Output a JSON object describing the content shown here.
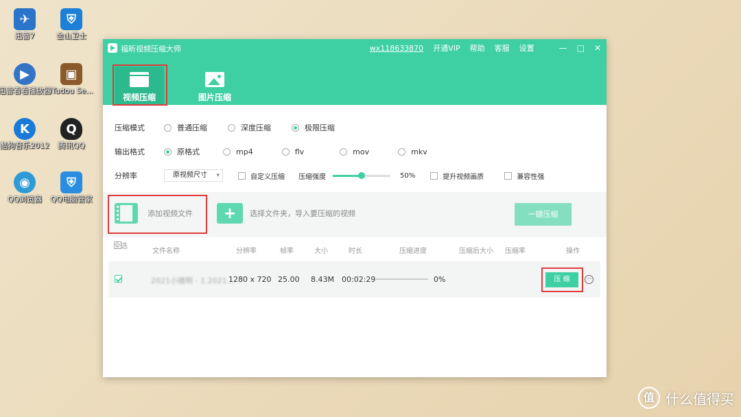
{
  "desktop": {
    "icons": [
      {
        "label": "迅雷7",
        "icon": "thunder-icon",
        "color": "#2a74c9"
      },
      {
        "label": "金山卫士",
        "icon": "kingsoft-guard-icon",
        "color": "#1d7fd6"
      },
      {
        "label": "迅雷看看播放器",
        "icon": "xunlei-player-icon",
        "color": "#3175c4"
      },
      {
        "label": "iTudou Se...",
        "icon": "tudou-icon",
        "color": "#8a5a2b"
      },
      {
        "label": "酷狗音乐2012",
        "icon": "kugou-icon",
        "color": "#1a7ad9"
      },
      {
        "label": "腾讯QQ",
        "icon": "qq-penguin-icon",
        "color": "#222222"
      },
      {
        "label": "QQ浏览器",
        "icon": "qq-browser-icon",
        "color": "#2f9bd6"
      },
      {
        "label": "QQ电脑管家",
        "icon": "qq-pc-manager-icon",
        "color": "#2a8de0"
      }
    ]
  },
  "window": {
    "title": "福昕视频压缩大师",
    "account": "wx118633870",
    "nav": {
      "vip": "开通VIP",
      "help": "帮助",
      "service": "客服",
      "settings": "设置"
    },
    "controls": {
      "min": "—",
      "max": "□",
      "close": "✕"
    },
    "tabs": [
      {
        "label": "视频压缩",
        "icon": "clapperboard-icon",
        "active": true
      },
      {
        "label": "图片压缩",
        "icon": "image-icon",
        "active": false
      }
    ]
  },
  "settings": {
    "mode": {
      "label": "压缩模式",
      "options": [
        "普通压缩",
        "深度压缩",
        "极限压缩"
      ],
      "selected": 2
    },
    "format": {
      "label": "输出格式",
      "options": [
        "原格式",
        "mp4",
        "flv",
        "mov",
        "mkv"
      ],
      "selected": 0
    },
    "resolution": {
      "label": "分辨率",
      "select_value": "原视频尺寸",
      "custom_label": "自定义压缩",
      "strength_label": "压缩强度",
      "strength_value": 50,
      "strength_text": "50%",
      "enhance_label": "提升视频画质",
      "compat_label": "兼容性强"
    }
  },
  "actions": {
    "add_file": "添加视频文件",
    "add_folder": "选择文件夹，导入要压缩的视频",
    "one_click": "一键压缩"
  },
  "table": {
    "headers": [
      "全选",
      "文件名称",
      "分辨率",
      "帧率",
      "大小",
      "时长",
      "压缩进度",
      "压缩后大小",
      "压缩率",
      "操作"
    ],
    "rows": [
      {
        "checked": true,
        "name": "2021小猪啊 - 1.2021...",
        "resolution": "1280 x 720",
        "fps": "25.00",
        "size": "8.43M",
        "duration": "00:02:29",
        "progress": 0,
        "progress_text": "0%",
        "compress_label": "压 缩",
        "more": "···"
      }
    ]
  },
  "watermark": {
    "logo": "值",
    "text": "什么值得买"
  },
  "colors": {
    "accent": "#3ecfa2",
    "highlight": "#e23a3a"
  }
}
